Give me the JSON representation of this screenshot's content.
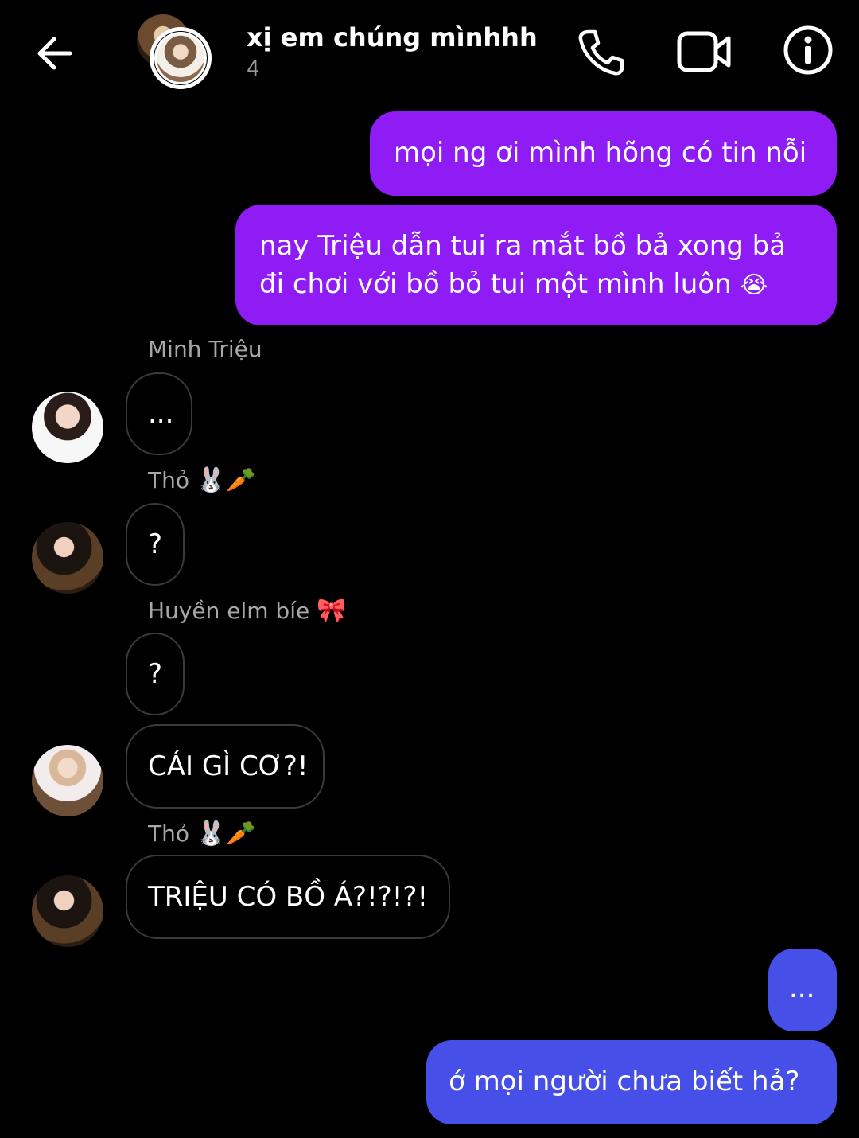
{
  "header": {
    "group_name": "xị em chúng mìnhhh",
    "member_count": "4",
    "icons": [
      "back-arrow-icon",
      "phone-icon",
      "video-camera-icon",
      "info-icon"
    ]
  },
  "colors": {
    "background": "#000000",
    "outgoing_purple": "#8f1cf5",
    "outgoing_blue": "#4650e8",
    "incoming_border": "#3a3a3a",
    "sender_name": "#a7a7a7"
  },
  "messages": {
    "m1": "mọi ng ơi mình hõng có tin nỗi",
    "m2_line1": "nay Triệu dẫn tui ra mắt bồ bả xong bả",
    "m2_line2": "đi chơi với bồ bỏ tui một mình luôn",
    "m2_emoji": "😭",
    "m3_sender": "Minh Triệu",
    "m3": "...",
    "m4_sender": "Thỏ",
    "m4_sender_emoji": "🐰🥕",
    "m4": "?",
    "m5_sender": "Huyền elm bíe",
    "m5_sender_emoji": "🎀",
    "m5": "?",
    "m6": "CÁI GÌ CƠ?!",
    "m7_sender": "Thỏ",
    "m7_sender_emoji": "🐰🥕",
    "m7": "TRIỆU CÓ BỒ Á?!?!?!",
    "m8": "...",
    "m9": "ớ mọi người chưa biết hả?"
  }
}
